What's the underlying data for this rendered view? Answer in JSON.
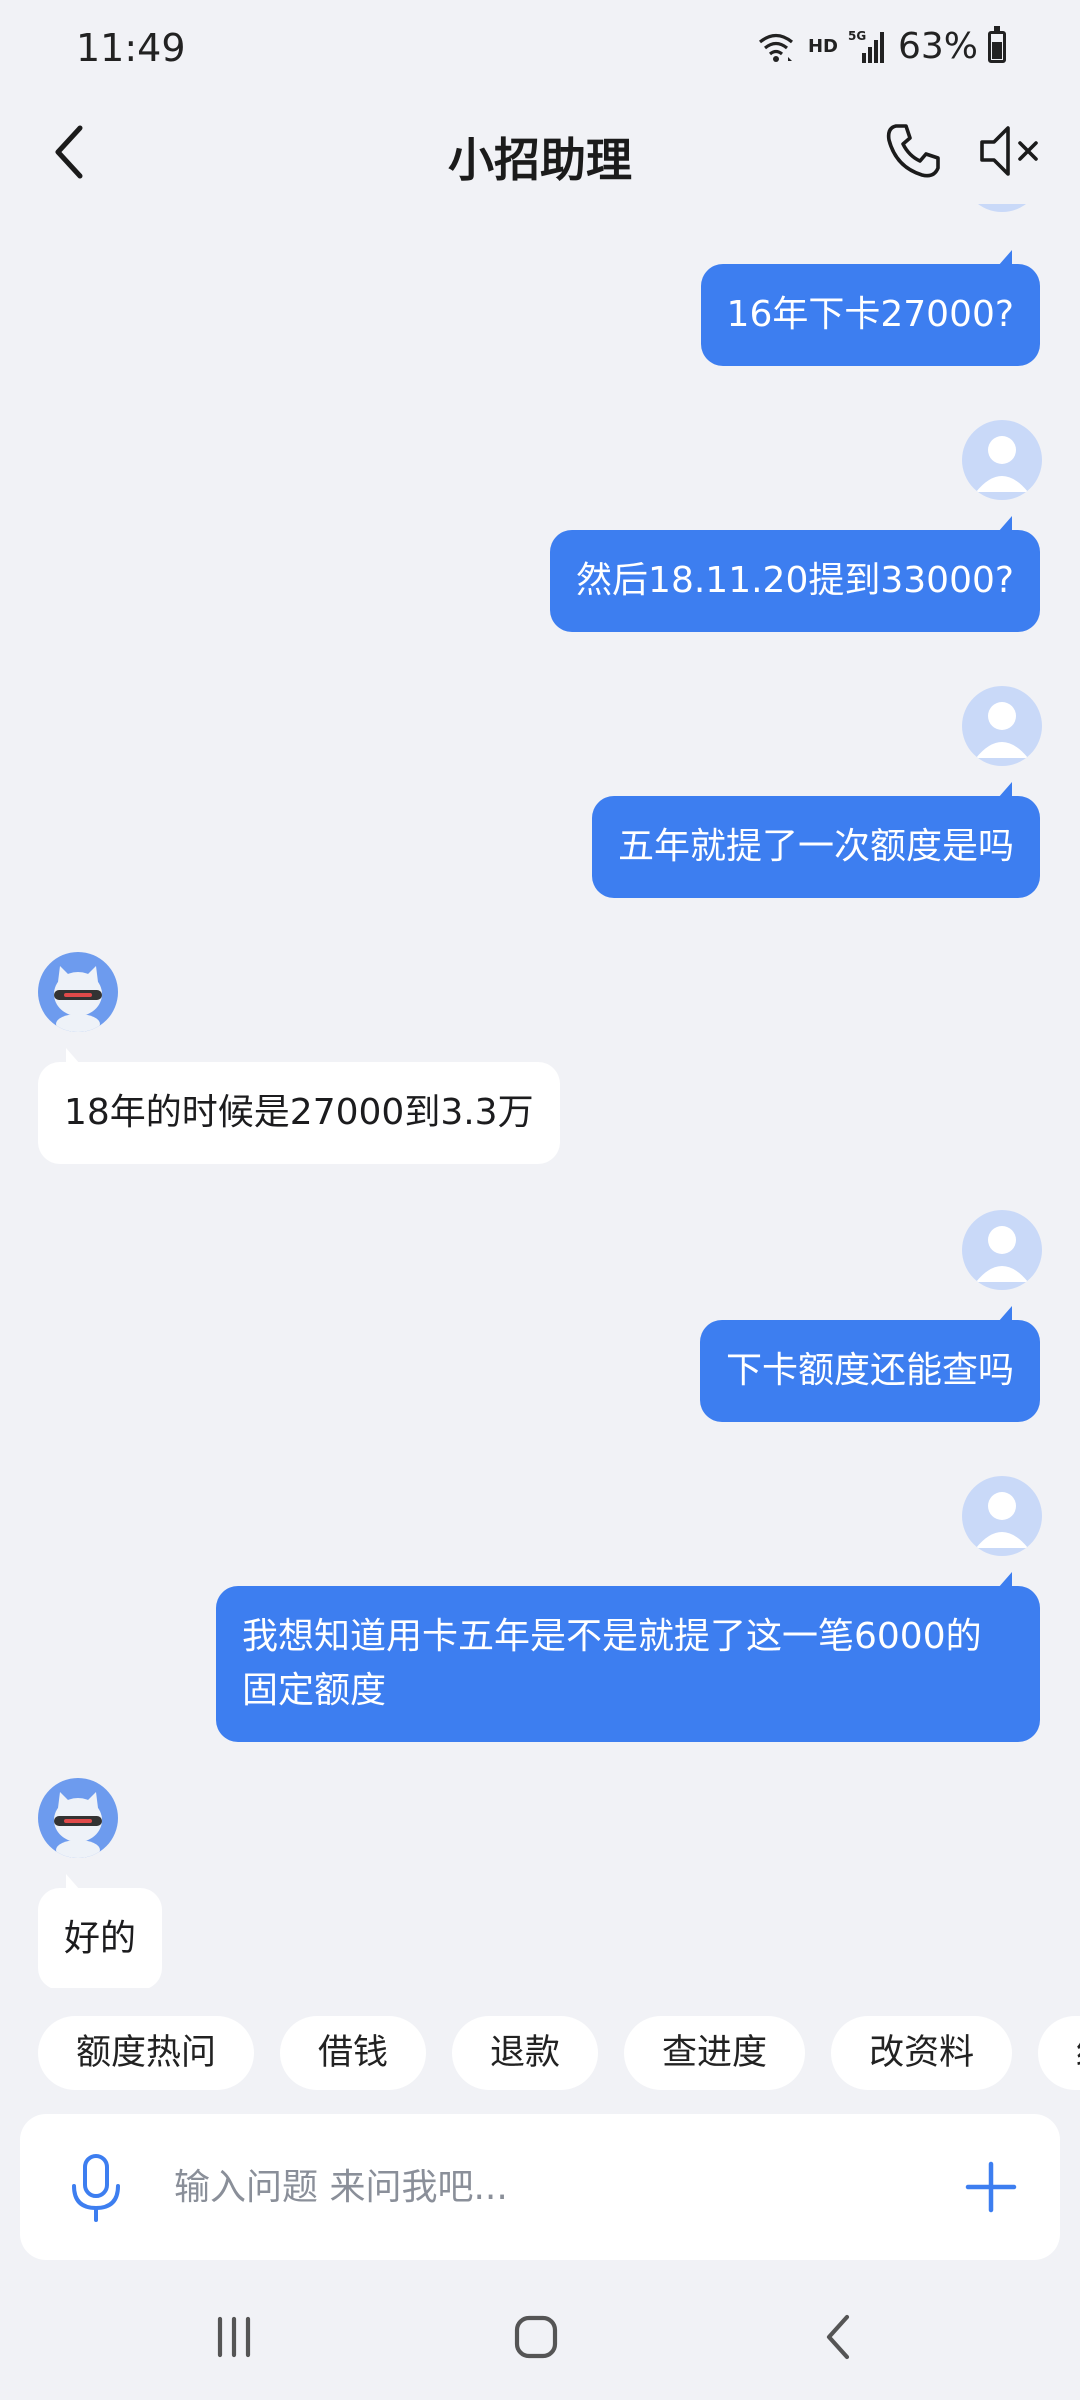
{
  "status_bar": {
    "time": "11:49",
    "network": "HD",
    "signal_type": "5G",
    "battery": "63%",
    "battery_level": 0.63,
    "icons": [
      "wifi-icon",
      "signal-icon",
      "battery-icon"
    ]
  },
  "header": {
    "title": "小招助理",
    "back_icon": "chevron-left-icon",
    "call_icon": "phone-icon",
    "mute_icon": "speaker-muted-icon"
  },
  "messages": [
    {
      "sender": "user",
      "text": "16年下卡27000?"
    },
    {
      "sender": "user",
      "text": "然后18.11.20提到33000?"
    },
    {
      "sender": "user",
      "text": "五年就提了一次额度是吗"
    },
    {
      "sender": "bot",
      "text": "18年的时候是27000到3.3万"
    },
    {
      "sender": "user",
      "text": "下卡额度还能查吗"
    },
    {
      "sender": "user",
      "text": "我想知道用卡五年是不是就提了这一笔6000的固定额度"
    },
    {
      "sender": "bot",
      "text": "好的"
    }
  ],
  "quick_replies": [
    "额度热问",
    "借钱",
    "退款",
    "查进度",
    "改资料",
    "结"
  ],
  "input": {
    "placeholder": "输入问题 来问我吧...",
    "value": "",
    "mic_icon": "microphone-icon",
    "add_icon": "plus-icon"
  },
  "nav_bar": {
    "icons": [
      "recent-apps-icon",
      "home-icon",
      "back-icon"
    ]
  },
  "colors": {
    "user_bubble": "#3d7ef0",
    "bot_bubble": "#ffffff",
    "background": "#f1f2f6",
    "accent": "#3d7ef0"
  }
}
